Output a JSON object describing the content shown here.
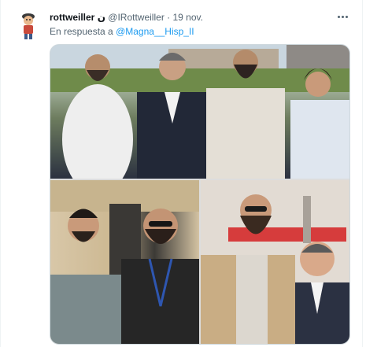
{
  "tweet": {
    "display_name": "rottweiller ن",
    "handle": "@IRottweiller",
    "separator": "·",
    "date": "19 nov.",
    "reply_prefix": "En respuesta a",
    "reply_to": "@Magna__Hisp_II",
    "more_icon": "more-horizontal-icon"
  },
  "media": {
    "photo_count": 3
  },
  "colors": {
    "link": "#1d9bf0",
    "muted": "#536471",
    "text": "#0f1419"
  }
}
